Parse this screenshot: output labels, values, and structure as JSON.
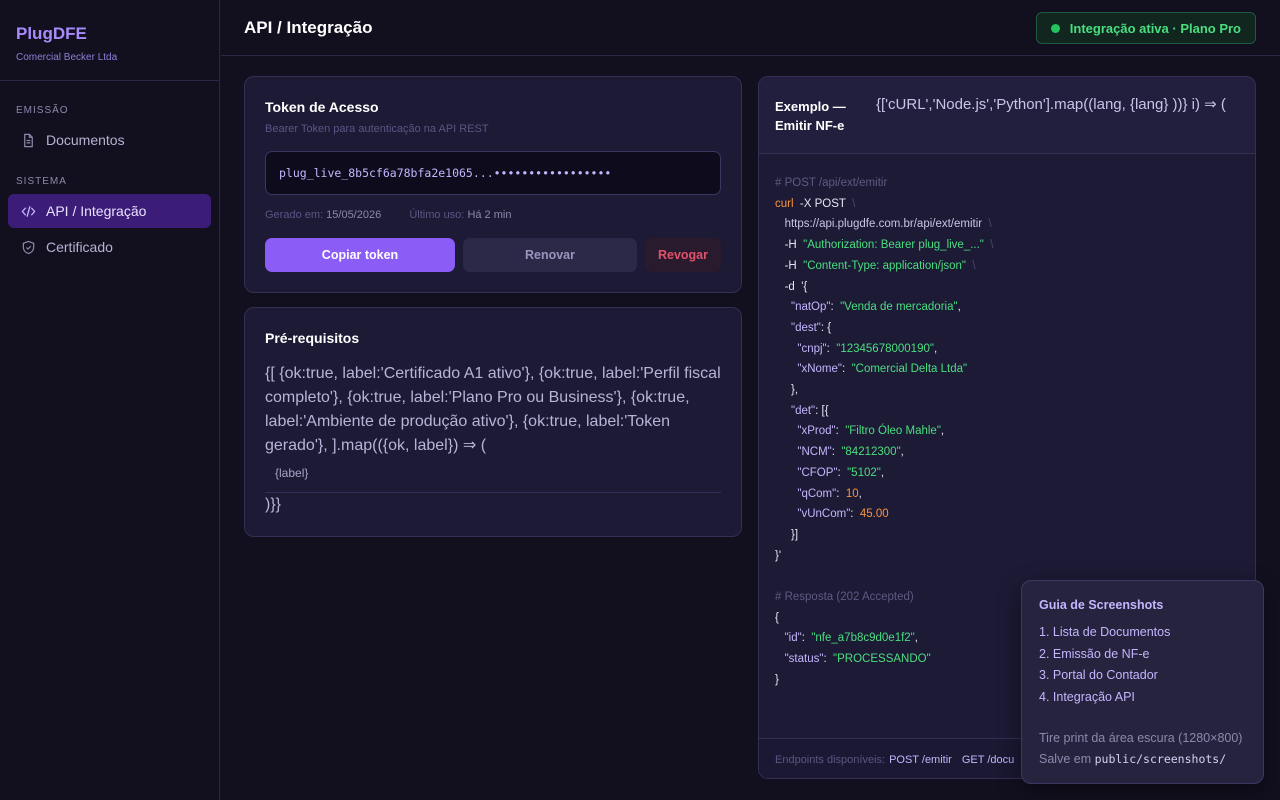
{
  "sidebar": {
    "brand": "PlugDFE",
    "company": "Comercial Becker Ltda",
    "sections": [
      {
        "label": "EMISSÃO",
        "items": [
          {
            "label": "Documentos",
            "icon": "document-icon"
          }
        ]
      },
      {
        "label": "SISTEMA",
        "items": [
          {
            "label": "API / Integração",
            "icon": "code-icon",
            "active": true
          },
          {
            "label": "Certificado",
            "icon": "shield-icon"
          }
        ]
      }
    ]
  },
  "header": {
    "title": "API / Integração",
    "status": "Integração ativa · Plano Pro"
  },
  "token": {
    "title": "Token de Acesso",
    "subtitle": "Bearer Token para autenticação na API REST",
    "value": "plug_live_8b5cf6a78bfa2e1065...•••••••••••••••••",
    "generated_label": "Gerado em:",
    "generated_value": "15/05/2026",
    "last_use_label": "Último uso:",
    "last_use_value": "Há 2 min",
    "copy_label": "Copiar token",
    "renew_label": "Renovar",
    "revoke_label": "Revogar"
  },
  "prereq": {
    "title": "Pré-requisitos",
    "raw_code": "{[ {ok:true, label:'Certificado A1 ativo'}, {ok:true, label:'Perfil fiscal completo'}, {ok:true, label:'Plano Pro ou Business'}, {ok:true, label:'Ambiente de produção ativo'}, {ok:true, label:'Token gerado'}, ].map(({ok, label}) ⇒ (",
    "item_label": "{label}",
    "close": ")}}"
  },
  "example": {
    "title": "Exemplo — Emitir NF-e",
    "tabs_raw": "{['cURL','Node.js','Python'].map((lang, {lang} ))} i) ⇒ (",
    "code": {
      "comment_post": "# POST /api/ext/emitir",
      "cmd": "curl",
      "method": "-X POST",
      "url": "https://api.plugdfe.com.br/api/ext/emitir",
      "h_flag": "-H",
      "auth_header": "\"Authorization: Bearer plug_live_...\"",
      "content_header": "\"Content-Type: application/json\"",
      "d_flag": "-d",
      "open": "'{",
      "natOp_key": "\"natOp\"",
      "natOp_val": "\"Venda de mercadoria\"",
      "dest_key": "\"dest\"",
      "cnpj_key": "\"cnpj\"",
      "cnpj_val": "\"12345678000190\"",
      "xNome_key": "\"xNome\"",
      "xNome_val": "\"Comercial Delta Ltda\"",
      "det_key": "\"det\"",
      "xProd_key": "\"xProd\"",
      "xProd_val": "\"Filtro Óleo Mahle\"",
      "ncm_key": "\"NCM\"",
      "ncm_val": "\"84212300\"",
      "cfop_key": "\"CFOP\"",
      "cfop_val": "\"5102\"",
      "qcom_key": "\"qCom\"",
      "qcom_val": "10",
      "vuncom_key": "\"vUnCom\"",
      "vuncom_val": "45.00",
      "close_arr": "}]",
      "close_body": "}'",
      "comment_resp": "# Resposta (202 Accepted)",
      "id_key": "\"id\"",
      "id_val": "\"nfe_a7b8c9d0e1f2\"",
      "status_key": "\"status\"",
      "status_val": "\"PROCESSANDO\""
    },
    "footer_label": "Endpoints disponíveis:",
    "footer_ep1": "POST /emitir",
    "footer_ep2": "GET /docu"
  },
  "guide": {
    "title": "Guia de Screenshots",
    "items": [
      "1. Lista de Documentos",
      "2. Emissão de NF-e",
      "3. Portal do Contador",
      "4. Integração API"
    ],
    "note1": "Tire print da área escura (1280×800)",
    "note2_prefix": "Salve em",
    "note2_path": "public/screenshots/"
  }
}
